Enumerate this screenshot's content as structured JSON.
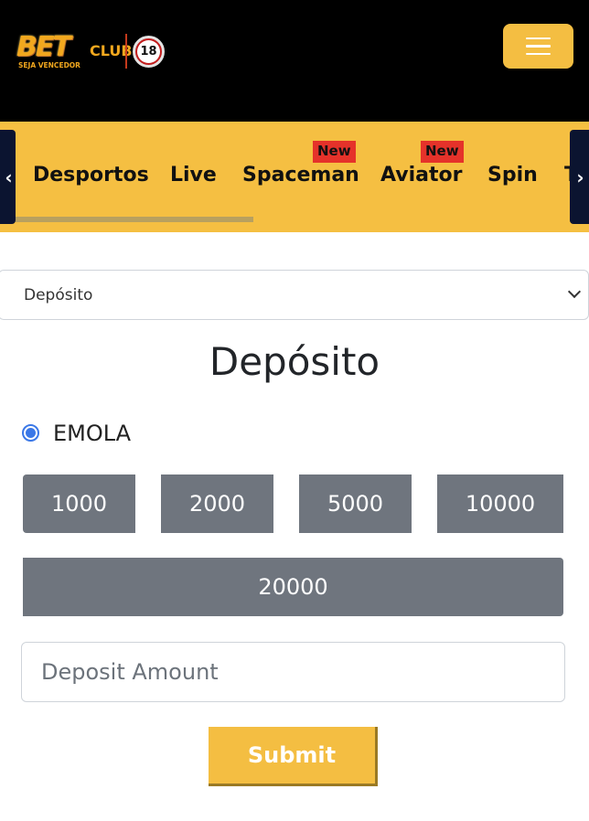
{
  "header": {
    "logo": {
      "brand": "BET",
      "brand_suffix": "CLUB",
      "tagline": "SEJA VENCEDOR",
      "age_badge": "18"
    },
    "menu_icon": "hamburger-icon"
  },
  "nav": {
    "prev_icon": "‹",
    "next_icon": "›",
    "items": [
      {
        "label": "Desportos",
        "badge": null
      },
      {
        "label": "Live",
        "badge": null
      },
      {
        "label": "Spaceman",
        "badge": "New"
      },
      {
        "label": "Aviator",
        "badge": "New"
      },
      {
        "label": "Spin",
        "badge": null
      },
      {
        "label": "T",
        "badge": null
      }
    ]
  },
  "form": {
    "select_value": "Depósito",
    "title": "Depósito",
    "payment_method": {
      "label": "EMOLA",
      "selected": true
    },
    "amounts": [
      "1000",
      "2000",
      "5000",
      "10000",
      "20000"
    ],
    "amount_input_placeholder": "Deposit Amount",
    "amount_input_value": "",
    "submit_label": "Submit"
  },
  "colors": {
    "accent": "#f5bf42",
    "header_bg": "#000000",
    "nav_arrow_bg": "#0b1430",
    "badge_bg": "#e5322a",
    "amount_button_bg": "#6f757e",
    "radio": "#3b78e7"
  }
}
